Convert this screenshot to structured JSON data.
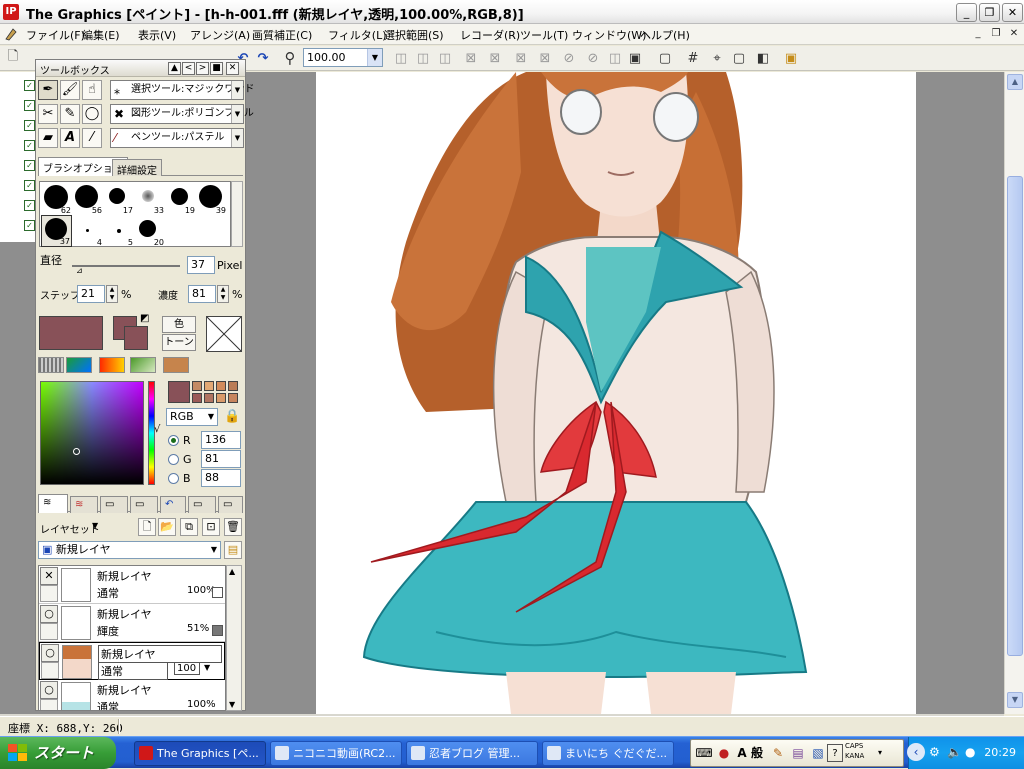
{
  "window": {
    "title": "The Graphics [ペイント] - [h-h-001.fff (新規レイヤ,透明,100.00%,RGB,8)]",
    "minimize_icon": "minimize-icon",
    "maximize_icon": "restore-icon",
    "close_icon": "close-icon"
  },
  "menu": {
    "items": [
      "ファイル(F)",
      "編集(E)",
      "表示(V)",
      "アレンジ(A)",
      "画質補正(C)",
      "フィルタ(L)",
      "選択範囲(S)",
      "レコーダ(R)",
      "ツール(T)",
      "ウィンドウ(W)",
      "ヘルプ(H)"
    ]
  },
  "toolbar": {
    "zoom_value": "100.00",
    "zoom_arrow": "▼"
  },
  "toolbox": {
    "title": "ツールボックス",
    "title_buttons": [
      "▲",
      "<",
      ">",
      "■",
      "✕"
    ],
    "tool_options": [
      {
        "icon": "magic-wand-icon",
        "label": "選択ツール:マジックワンド"
      },
      {
        "icon": "polygon-fill-icon",
        "label": "図形ツール:ポリゴンフィル"
      },
      {
        "icon": "pastel-pen-icon",
        "label": "ペンツール:パステル"
      }
    ],
    "tabs": [
      "ブラシオプション",
      "詳細設定"
    ],
    "brushes": [
      {
        "size": "62"
      },
      {
        "size": "56"
      },
      {
        "size": "17"
      },
      {
        "size": "33"
      },
      {
        "size": "19"
      },
      {
        "size": "39"
      },
      {
        "size": "37"
      },
      {
        "size": "4"
      },
      {
        "size": "5"
      },
      {
        "size": "20"
      }
    ],
    "diameter_label": "直径",
    "diameter_value": "37",
    "diameter_unit": "Pixel",
    "step_label": "ステップ",
    "step_value": "21",
    "step_unit": "%",
    "density_label": "濃度",
    "density_value": "81",
    "density_unit": "%",
    "color_btn": "色",
    "tone_btn": "トーン",
    "color_mode": "RGB",
    "r_label": "R",
    "r_value": "136",
    "g_label": "G",
    "g_value": "81",
    "b_label": "B",
    "b_value": "88",
    "current_color": "#885158",
    "swatches": [
      "#885158",
      "#d99a6a",
      "#c7855e",
      "#ba7c56",
      "#9b5a58",
      "#b07462",
      "#e2a874",
      "#d28b5b"
    ]
  },
  "layers": {
    "set_label": "レイヤセット",
    "current_layer": "新規レイヤ",
    "rows": [
      {
        "visible": "✕",
        "name": "新規レイヤ",
        "mode": "通常",
        "opacity": "100%"
      },
      {
        "visible": "○",
        "name": "新規レイヤ",
        "mode": "輝度",
        "opacity": "51%"
      },
      {
        "visible": "○",
        "name": "新規レイヤ",
        "mode": "通常",
        "opacity": "100"
      },
      {
        "visible": "○",
        "name": "新規レイヤ",
        "mode": "通常",
        "opacity": "100%"
      }
    ]
  },
  "status": {
    "coords": "座標 X: 688,Y: 260"
  },
  "taskbar": {
    "start": "スタート",
    "tasks": [
      {
        "label": "The Graphics [ペ...",
        "active": true
      },
      {
        "label": "ニコニコ動画(RC2...",
        "active": false
      },
      {
        "label": "忍者ブログ 管理...",
        "active": false
      },
      {
        "label": "まいにち ぐだぐだ...",
        "active": false
      }
    ],
    "ime": [
      "A",
      "般"
    ],
    "caps": "CAPS",
    "kana": "KANA",
    "clock": "20:29"
  }
}
